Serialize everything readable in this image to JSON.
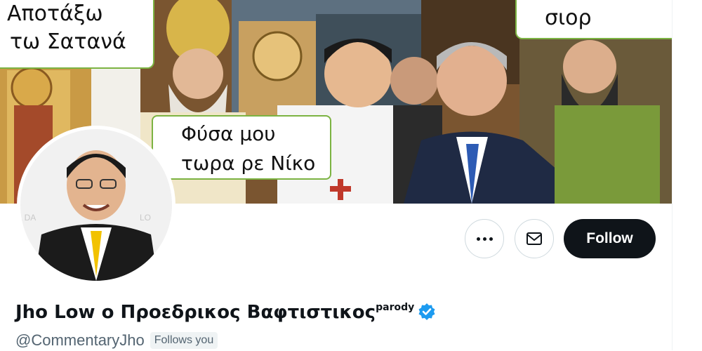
{
  "banner": {
    "bubble_left": {
      "lines": [
        "Αποτάξω",
        "τω Σατανά"
      ]
    },
    "bubble_center": {
      "lines": [
        "Φύσα μου",
        "τωρα ρε Νίκο"
      ]
    },
    "bubble_right": {
      "lines": [
        "σιορ"
      ]
    }
  },
  "profile": {
    "display_name": "Jho Low ο Προεδρικος Βαφτιστικος",
    "parody_label": "parody",
    "handle": "@CommentaryJho",
    "follows_you_label": "Follows you",
    "verified": true
  },
  "actions": {
    "follow_label": "Follow",
    "more_icon": "more-horizontal-icon",
    "message_icon": "envelope-icon"
  },
  "colors": {
    "follow_bg": "#0f1419",
    "verified_blue": "#1d9bf0",
    "bubble_border": "#7cb342",
    "secondary_text": "#536471"
  }
}
